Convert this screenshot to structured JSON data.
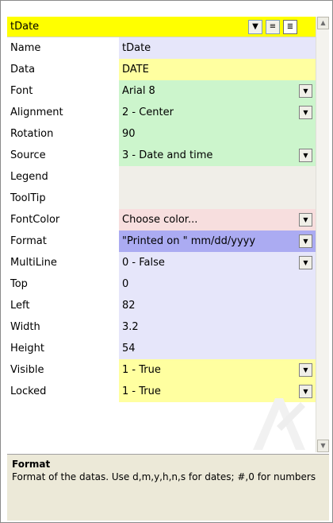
{
  "selector": {
    "value": "tDate"
  },
  "toolbar": {
    "categorized_glyph": "≡",
    "alphabetic_glyph": "≣"
  },
  "colors": {
    "lavender": "#e6e6fa",
    "yellow": "#ffffa0",
    "green": "#ccf5cc",
    "gray": "#f0eee8",
    "pink": "#f7dede",
    "blue": "#ababf2"
  },
  "properties": [
    {
      "label": "Name",
      "value": "tDate",
      "color": "lavender",
      "dropdown": false
    },
    {
      "label": "Data",
      "value": "DATE",
      "color": "yellow",
      "dropdown": false
    },
    {
      "label": "Font",
      "value": "Arial 8",
      "color": "green",
      "dropdown": true
    },
    {
      "label": "Alignment",
      "value": "2 - Center",
      "color": "green",
      "dropdown": true
    },
    {
      "label": "Rotation",
      "value": "90",
      "color": "green",
      "dropdown": false
    },
    {
      "label": "Source",
      "value": "3 - Date and time",
      "color": "green",
      "dropdown": true
    },
    {
      "label": "Legend",
      "value": "",
      "color": "gray",
      "dropdown": false
    },
    {
      "label": "ToolTip",
      "value": "",
      "color": "gray",
      "dropdown": false
    },
    {
      "label": "FontColor",
      "value": "Choose color...",
      "color": "pink",
      "dropdown": true
    },
    {
      "label": "Format",
      "value": " \"Printed on \" mm/dd/yyyy",
      "color": "blue",
      "dropdown": true
    },
    {
      "label": "MultiLine",
      "value": "0 - False",
      "color": "lavender",
      "dropdown": true
    },
    {
      "label": "Top",
      "value": "0",
      "color": "lavender",
      "dropdown": false
    },
    {
      "label": "Left",
      "value": "82",
      "color": "lavender",
      "dropdown": false
    },
    {
      "label": "Width",
      "value": "3.2",
      "color": "lavender",
      "dropdown": false
    },
    {
      "label": "Height",
      "value": "54",
      "color": "lavender",
      "dropdown": false
    },
    {
      "label": "Visible",
      "value": "1 - True",
      "color": "yellow",
      "dropdown": true
    },
    {
      "label": "Locked",
      "value": "1 - True",
      "color": "yellow",
      "dropdown": true
    }
  ],
  "help": {
    "title": "Format",
    "text": "Format of the datas. Use d,m,y,h,n,s for dates; #,0 for numbers"
  }
}
